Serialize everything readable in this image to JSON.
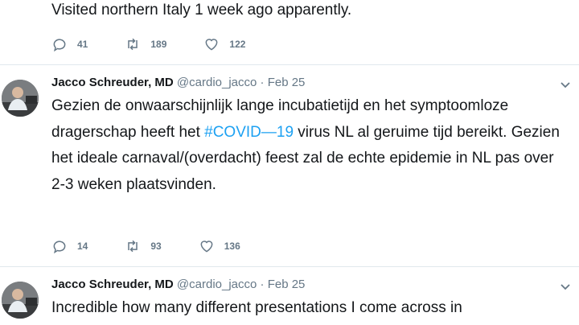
{
  "tweet_prev": {
    "text": "Visited northern Italy 1 week ago apparently.",
    "replies": "41",
    "retweets": "189",
    "likes": "122"
  },
  "tweet1": {
    "author_name": "Jacco Schreuder, MD",
    "handle": "@cardio_jacco",
    "separator": "·",
    "date": "Feb 25",
    "text_before": "Gezien de onwaarschijnlijk lange incubatietijd en het symptoomloze dragerschap heeft het ",
    "hashtag": "#COVID—19",
    "text_after": " virus NL al geruime tijd bereikt. Gezien het ideale carnaval/(overdacht) feest zal de echte epidemie in NL pas over 2-3 weken plaatsvinden.",
    "replies": "14",
    "retweets": "93",
    "likes": "136"
  },
  "tweet2": {
    "author_name": "Jacco Schreuder, MD",
    "handle": "@cardio_jacco",
    "separator": "·",
    "date": "Feb 25",
    "text": "Incredible how many different presentations I come across in"
  },
  "icons": {
    "reply": "reply-icon",
    "retweet": "retweet-icon",
    "like": "heart-icon",
    "menu": "chevron-down-icon"
  },
  "colors": {
    "meta_gray": "#657786",
    "hashtag_blue": "#1da1f2",
    "divider": "#e1e8ed"
  }
}
